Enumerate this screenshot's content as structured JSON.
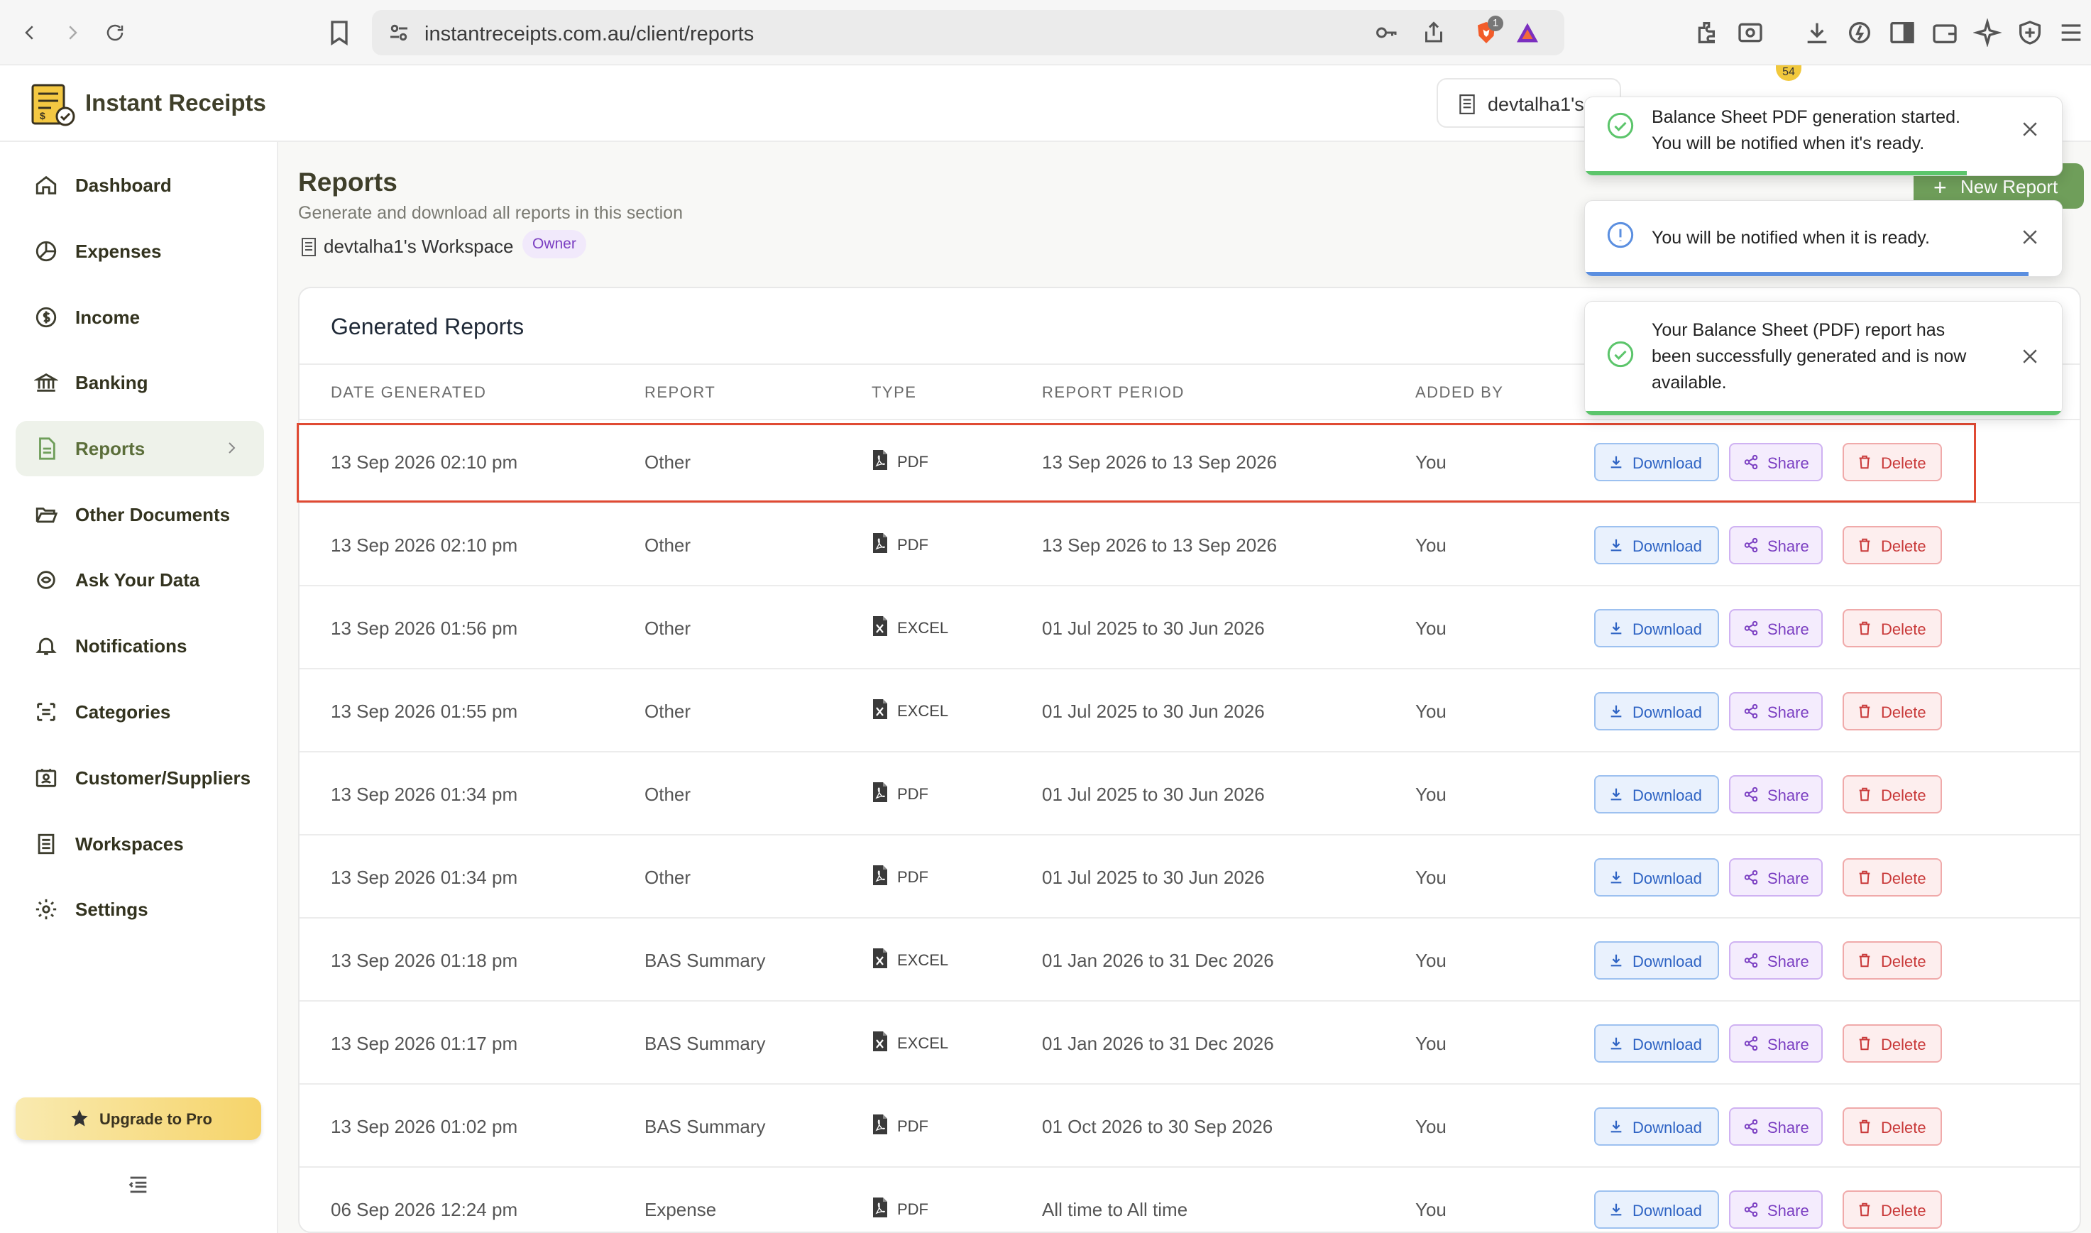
{
  "browser": {
    "url": "instantreceipts.com.au/client/reports",
    "shields_count": "1"
  },
  "app": {
    "brand": "Instant Receipts",
    "workspace_switcher": "devtalha1's",
    "notification_count": "54"
  },
  "sidebar": {
    "items": [
      {
        "label": "Dashboard",
        "icon": "home-icon"
      },
      {
        "label": "Expenses",
        "icon": "pie-chart-icon"
      },
      {
        "label": "Income",
        "icon": "dollar-circle-icon"
      },
      {
        "label": "Banking",
        "icon": "bank-icon"
      },
      {
        "label": "Reports",
        "icon": "file-icon",
        "active": true
      },
      {
        "label": "Other Documents",
        "icon": "folder-open-icon"
      },
      {
        "label": "Ask Your Data",
        "icon": "chat-ai-icon"
      },
      {
        "label": "Notifications",
        "icon": "bell-icon"
      },
      {
        "label": "Categories",
        "icon": "categories-icon"
      },
      {
        "label": "Customer/Suppliers",
        "icon": "contacts-icon"
      },
      {
        "label": "Workspaces",
        "icon": "building-icon"
      },
      {
        "label": "Settings",
        "icon": "gear-icon"
      }
    ],
    "upgrade_label": "Upgrade to Pro"
  },
  "page": {
    "title": "Reports",
    "subtitle": "Generate and download all reports in this section",
    "workspace_name": "devtalha1's Workspace",
    "owner_badge": "Owner",
    "new_report_label": "New Report"
  },
  "table": {
    "title": "Generated Reports",
    "columns": [
      "DATE GENERATED",
      "REPORT",
      "TYPE",
      "REPORT PERIOD",
      "ADDED BY"
    ],
    "rows": [
      {
        "date": "13 Sep 2026 02:10 pm",
        "report": "Other",
        "type": "PDF",
        "period": "13 Sep 2026 to 13 Sep 2026",
        "added_by": "You"
      },
      {
        "date": "13 Sep 2026 02:10 pm",
        "report": "Other",
        "type": "PDF",
        "period": "13 Sep 2026 to 13 Sep 2026",
        "added_by": "You"
      },
      {
        "date": "13 Sep 2026 01:56 pm",
        "report": "Other",
        "type": "EXCEL",
        "period": "01 Jul 2025 to 30 Jun 2026",
        "added_by": "You"
      },
      {
        "date": "13 Sep 2026 01:55 pm",
        "report": "Other",
        "type": "EXCEL",
        "period": "01 Jul 2025 to 30 Jun 2026",
        "added_by": "You"
      },
      {
        "date": "13 Sep 2026 01:34 pm",
        "report": "Other",
        "type": "PDF",
        "period": "01 Jul 2025 to 30 Jun 2026",
        "added_by": "You"
      },
      {
        "date": "13 Sep 2026 01:34 pm",
        "report": "Other",
        "type": "PDF",
        "period": "01 Jul 2025 to 30 Jun 2026",
        "added_by": "You"
      },
      {
        "date": "13 Sep 2026 01:18 pm",
        "report": "BAS Summary",
        "type": "EXCEL",
        "period": "01 Jan 2026 to 31 Dec 2026",
        "added_by": "You"
      },
      {
        "date": "13 Sep 2026 01:17 pm",
        "report": "BAS Summary",
        "type": "EXCEL",
        "period": "01 Jan 2026 to 31 Dec 2026",
        "added_by": "You"
      },
      {
        "date": "13 Sep 2026 01:02 pm",
        "report": "BAS Summary",
        "type": "PDF",
        "period": "01 Oct 2026 to 30 Sep 2026",
        "added_by": "You"
      },
      {
        "date": "06 Sep 2026 12:24 pm",
        "report": "Expense",
        "type": "PDF",
        "period": "All time to All time",
        "added_by": "You"
      }
    ],
    "actions": {
      "download": "Download",
      "share": "Share",
      "delete": "Delete"
    }
  },
  "toasts": [
    {
      "type": "success",
      "line1": "Balance Sheet PDF generation started.",
      "line2": "You will be notified when it's ready.",
      "line3": "",
      "progress": 0.8,
      "color": "#5cc56b"
    },
    {
      "type": "info",
      "line1": "You will be notified when it is ready.",
      "line2": "",
      "line3": "",
      "progress": 0.93,
      "color": "#5b8fe0"
    },
    {
      "type": "success",
      "line1": "Your Balance Sheet (PDF) report has",
      "line2": "been successfully generated and is now",
      "line3": "available.",
      "progress": 1.0,
      "color": "#5cc56b"
    }
  ],
  "colors": {
    "accent_green": "#6f9e5a",
    "highlight_red": "#e04a33",
    "download_blue": "#2f64c4",
    "share_purple": "#7b3fc2",
    "delete_red": "#c93a3a"
  }
}
